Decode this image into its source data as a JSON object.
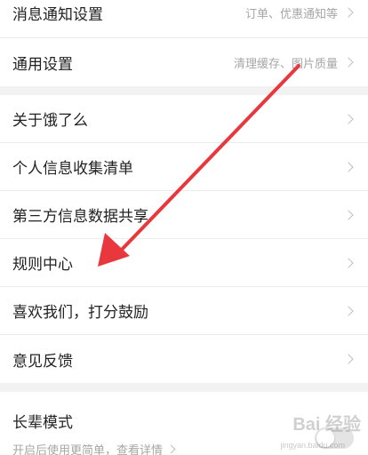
{
  "settings_group_1": {
    "items": [
      {
        "label": "消息通知设置",
        "detail": "订单、优惠通知等"
      },
      {
        "label": "通用设置",
        "detail": "清理缓存、图片质量"
      }
    ]
  },
  "settings_group_2": {
    "items": [
      {
        "label": "关于饿了么"
      },
      {
        "label": "个人信息收集清单"
      },
      {
        "label": "第三方信息数据共享"
      },
      {
        "label": "规则中心"
      },
      {
        "label": "喜欢我们，打分鼓励"
      },
      {
        "label": "意见反馈"
      }
    ]
  },
  "elder_mode": {
    "title": "长辈模式",
    "subtitle": "开启后使用更简单，查看详情",
    "toggle_on": false
  },
  "annotation": {
    "arrow_color": "#e8383d"
  },
  "watermark": {
    "text": "Bai 经验",
    "url": "jingyan.baidu.com"
  }
}
